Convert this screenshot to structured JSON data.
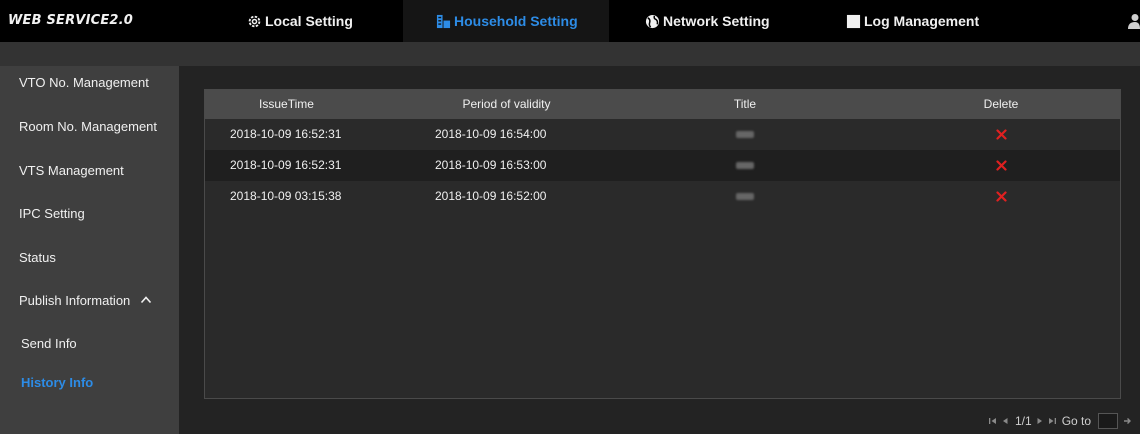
{
  "brand": "WEB SERVICE2.0",
  "nav": {
    "local": "Local Setting",
    "household": "Household Setting",
    "network": "Network Setting",
    "log": "Log Management"
  },
  "sidebar": {
    "items": [
      {
        "label": "VTO No. Management"
      },
      {
        "label": "Room No. Management"
      },
      {
        "label": "VTS Management"
      },
      {
        "label": "IPC Setting"
      },
      {
        "label": "Status"
      },
      {
        "label": "Publish Information"
      },
      {
        "label": "Send Info"
      },
      {
        "label": "History Info"
      }
    ]
  },
  "table": {
    "headers": [
      "IssueTime",
      "Period of validity",
      "Title",
      "Delete"
    ],
    "rows": [
      {
        "issue_time": "2018-10-09 16:52:31",
        "validity": "2018-10-09 16:54:00"
      },
      {
        "issue_time": "2018-10-09 16:52:31",
        "validity": "2018-10-09 16:53:00"
      },
      {
        "issue_time": "2018-10-09 03:15:38",
        "validity": "2018-10-09 16:52:00"
      }
    ]
  },
  "pager": {
    "page": "1/1",
    "goto_label": "Go to"
  },
  "colors": {
    "accent": "#2d8ce6",
    "delete": "#e02020"
  }
}
